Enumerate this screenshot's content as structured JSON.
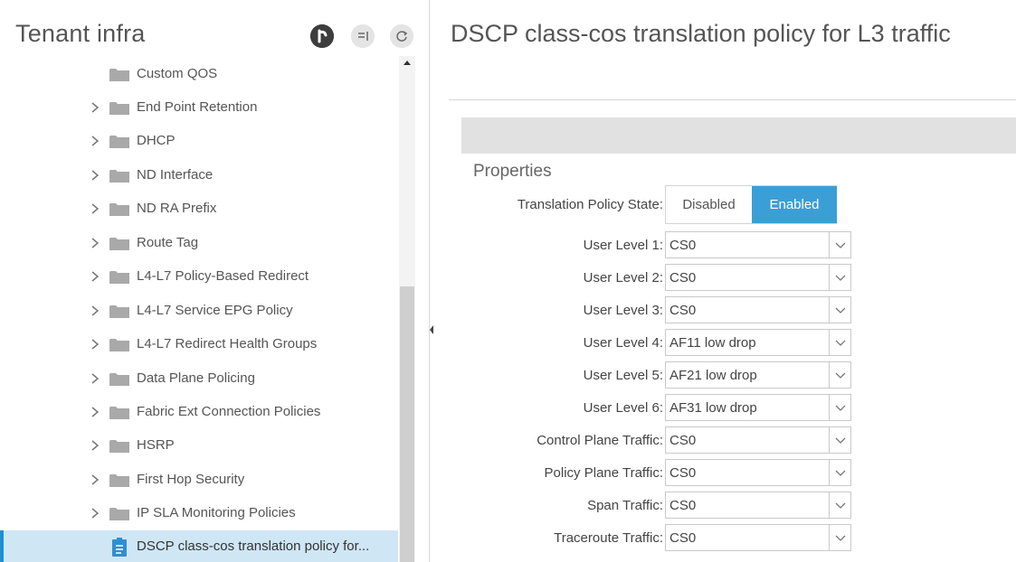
{
  "left": {
    "title": "Tenant infra",
    "icons": [
      "plus-icon",
      "list-icon",
      "refresh-icon"
    ],
    "tree": [
      {
        "label": "Custom QOS",
        "expandable": false
      },
      {
        "label": "End Point Retention",
        "expandable": true
      },
      {
        "label": "DHCP",
        "expandable": true
      },
      {
        "label": "ND Interface",
        "expandable": true
      },
      {
        "label": "ND RA Prefix",
        "expandable": true
      },
      {
        "label": "Route Tag",
        "expandable": true
      },
      {
        "label": "L4-L7 Policy-Based Redirect",
        "expandable": true
      },
      {
        "label": "L4-L7 Service EPG Policy",
        "expandable": true
      },
      {
        "label": "L4-L7 Redirect Health Groups",
        "expandable": true
      },
      {
        "label": "Data Plane Policing",
        "expandable": true
      },
      {
        "label": "Fabric Ext Connection Policies",
        "expandable": true
      },
      {
        "label": "HSRP",
        "expandable": true
      },
      {
        "label": "First Hop Security",
        "expandable": true
      },
      {
        "label": "IP SLA Monitoring Policies",
        "expandable": true
      },
      {
        "label": "DSCP class-cos translation policy for...",
        "expandable": false,
        "selected": true
      }
    ]
  },
  "right": {
    "title": "DSCP class-cos translation policy for L3 traffic",
    "properties_label": "Properties",
    "translation_state": {
      "label": "Translation Policy State:",
      "options": [
        "Disabled",
        "Enabled"
      ],
      "selected": "Enabled"
    },
    "fields": [
      {
        "label": "User Level 1:",
        "value": "CS0"
      },
      {
        "label": "User Level 2:",
        "value": "CS0"
      },
      {
        "label": "User Level 3:",
        "value": "CS0"
      },
      {
        "label": "User Level 4:",
        "value": "AF11 low drop"
      },
      {
        "label": "User Level 5:",
        "value": "AF21 low drop"
      },
      {
        "label": "User Level 6:",
        "value": "AF31 low drop"
      },
      {
        "label": "Control Plane Traffic:",
        "value": "CS0"
      },
      {
        "label": "Policy Plane Traffic:",
        "value": "CS0"
      },
      {
        "label": "Span Traffic:",
        "value": "CS0"
      },
      {
        "label": "Traceroute Traffic:",
        "value": "CS0"
      }
    ]
  },
  "colors": {
    "accent": "#3b9fd6",
    "selection_bg": "#cfe6f5",
    "selection_bar": "#1e8fd6"
  }
}
